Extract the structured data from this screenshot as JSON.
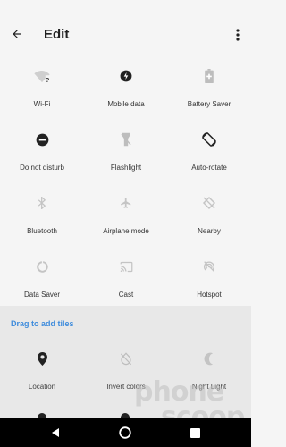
{
  "appbar": {
    "title": "Edit",
    "back_icon": "arrow-left-icon",
    "menu_icon": "more-vert-icon"
  },
  "active_tiles": [
    {
      "label": "Wi-Fi",
      "icon": "wifi-unknown-icon"
    },
    {
      "label": "Mobile data",
      "icon": "mobile-data-icon"
    },
    {
      "label": "Battery Saver",
      "icon": "battery-saver-icon"
    },
    {
      "label": "Do not disturb",
      "icon": "do-not-disturb-icon"
    },
    {
      "label": "Flashlight",
      "icon": "flashlight-off-icon"
    },
    {
      "label": "Auto-rotate",
      "icon": "auto-rotate-icon"
    },
    {
      "label": "Bluetooth",
      "icon": "bluetooth-icon"
    },
    {
      "label": "Airplane mode",
      "icon": "airplane-icon"
    },
    {
      "label": "Nearby",
      "icon": "nearby-off-icon"
    },
    {
      "label": "Data Saver",
      "icon": "data-saver-icon"
    },
    {
      "label": "Cast",
      "icon": "cast-icon"
    },
    {
      "label": "Hotspot",
      "icon": "hotspot-off-icon"
    }
  ],
  "drag_section": {
    "heading": "Drag to add tiles",
    "tiles": [
      {
        "label": "Location",
        "icon": "location-pin-icon"
      },
      {
        "label": "Invert colors",
        "icon": "invert-colors-off-icon"
      },
      {
        "label": "Night Light",
        "icon": "night-light-icon"
      }
    ]
  },
  "navbar": {
    "back": "nav-back-icon",
    "home": "nav-home-icon",
    "recents": "nav-recents-icon"
  },
  "watermark": {
    "line1": "phone",
    "line2": "scoop"
  },
  "colors": {
    "accent": "#3f8cdc",
    "background": "#f5f5f5",
    "drag_background": "#e8e8e8"
  }
}
